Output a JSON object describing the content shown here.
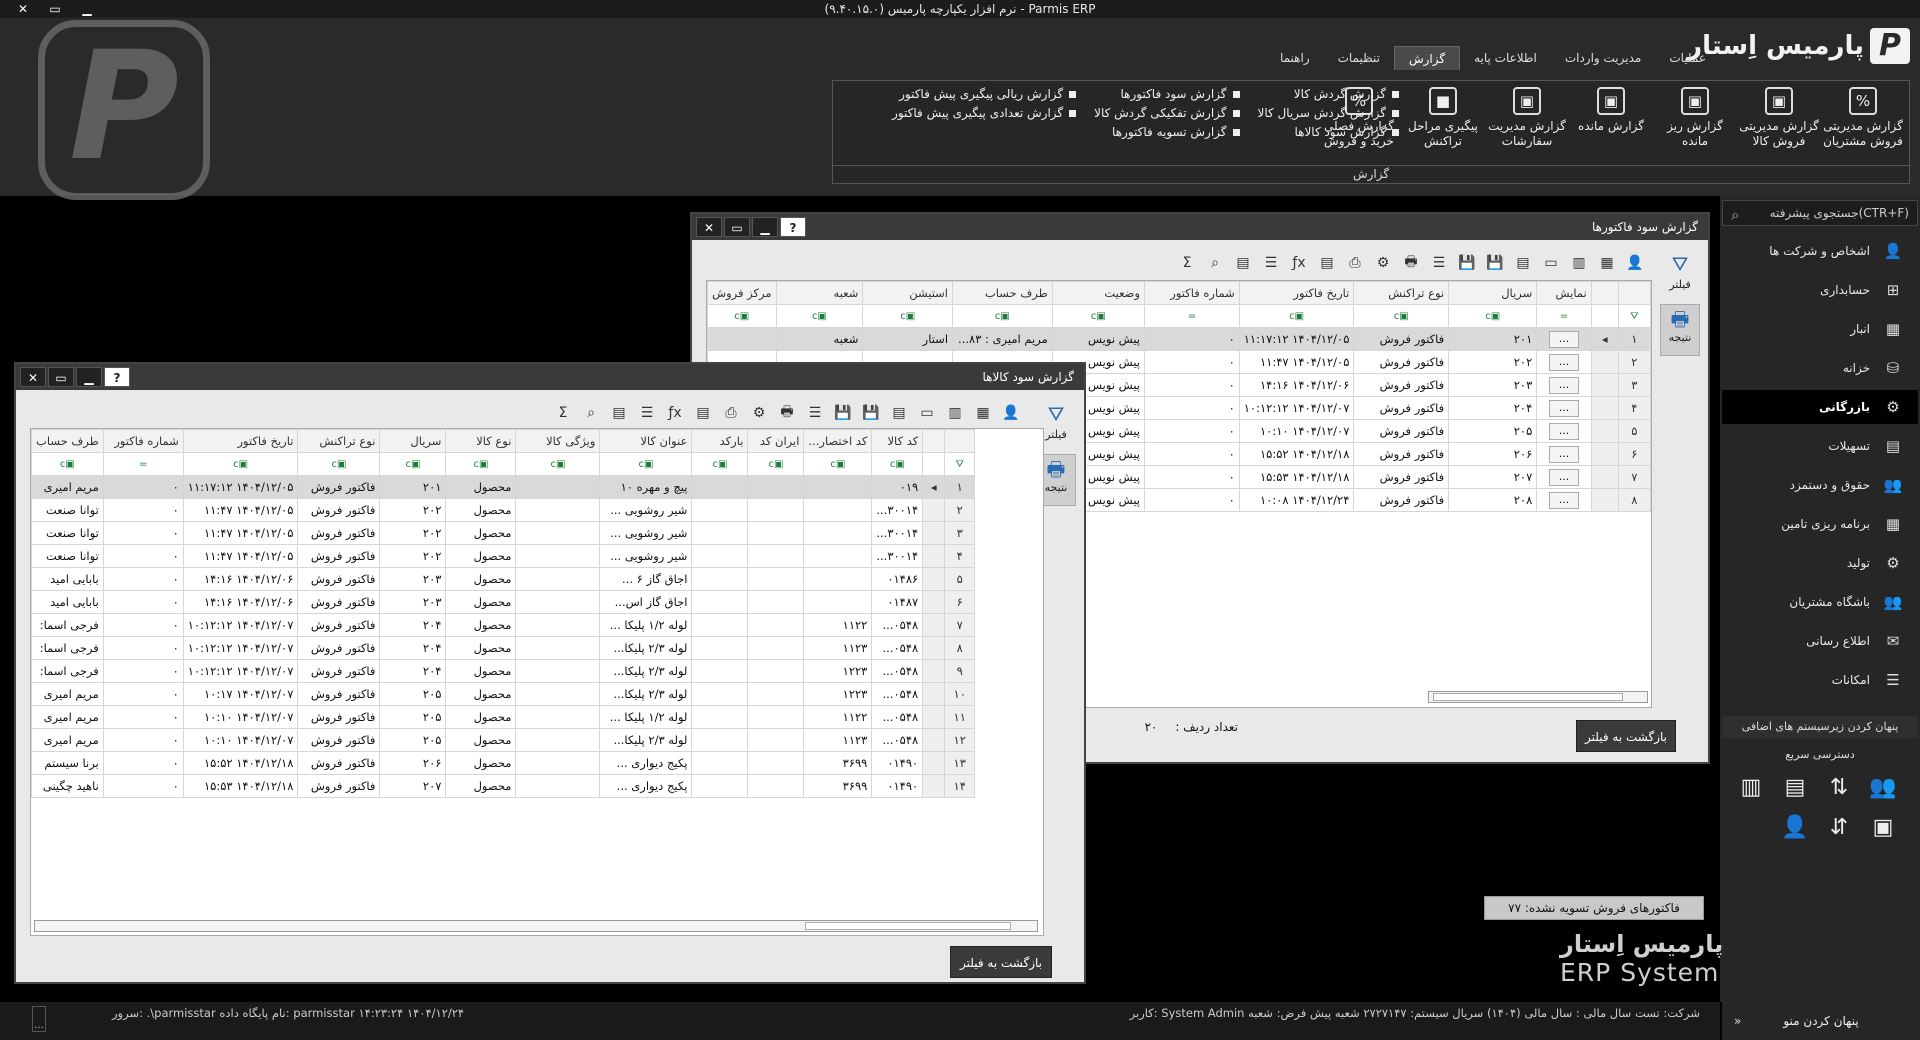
{
  "titlebar": {
    "title": "نرم افزار یکپارچه پارمیس (۹.۴۰.۱۵.۰) - Parmis ERP",
    "close": "✕",
    "restore": "▭",
    "minimize": "▁"
  },
  "brand": {
    "name": "پارمیس اِستار",
    "mark": "P"
  },
  "watermark": "P",
  "menu": [
    {
      "label": "عملیات"
    },
    {
      "label": "مدیریت واردات"
    },
    {
      "label": "اطلاعات پایه"
    },
    {
      "label": "گزارش",
      "active": true
    },
    {
      "label": "تنظیمات"
    },
    {
      "label": "راهنما"
    }
  ],
  "ribbon": {
    "big": [
      {
        "label": "گزارش مدیریتی فروش مشتریان",
        "icon": "%"
      },
      {
        "label": "گزارش مدیریتی فروش کالا",
        "icon": "▣"
      },
      {
        "label": "گزارش ریز مانده",
        "icon": "▣"
      },
      {
        "label": "گزارش مانده",
        "icon": "▣"
      },
      {
        "label": "گزارش مدیریت سفارشات",
        "icon": "▣"
      },
      {
        "label": "پیگیری مراحل تراکنش",
        "icon": "■"
      },
      {
        "label": "گزارش فصلی خرید و فروش",
        "icon": "%"
      }
    ],
    "small_cols": [
      [
        "گزارش گردش کالا",
        "گزارش گردش سریال کالا",
        "گزارش سود کالاها"
      ],
      [
        "گزارش سود فاکتورها",
        "گزارش تفکیکی گردش کالا",
        "گزارش تسویه فاکتورها"
      ],
      [
        "گزارش ریالی پیگیری پیش فاکتور",
        "گزارش تعدادی پیگیری پیش فاکتور"
      ]
    ],
    "group_label": "گزارش"
  },
  "sidebar": {
    "search_placeholder": "جستجوی پیشرفته(CTR+F)",
    "items": [
      {
        "label": "اشخاص و شرکت ها",
        "icon": "👤"
      },
      {
        "label": "حسابداری",
        "icon": "⊞"
      },
      {
        "label": "انبار",
        "icon": "▦"
      },
      {
        "label": "خزانه",
        "icon": "⛁"
      },
      {
        "label": "بازرگانی",
        "icon": "⚙",
        "active": true
      },
      {
        "label": "تسهیلات",
        "icon": "▤"
      },
      {
        "label": "حقوق و دستمزد",
        "icon": "👥"
      },
      {
        "label": "برنامه ریزی تامین",
        "icon": "▦"
      },
      {
        "label": "تولید",
        "icon": "⚙"
      },
      {
        "label": "باشگاه مشتریان",
        "icon": "👥"
      },
      {
        "label": "اطلاع رسانی",
        "icon": "✉"
      },
      {
        "label": "امکانات",
        "icon": "☰"
      }
    ],
    "hide_subsystems": "پنهان کردن زیرسیستم های اضافی",
    "quick_access": "دسترسی سریع",
    "quick_icons": [
      "👥",
      "⇅",
      "▤",
      "▥",
      "▣",
      "⇵",
      "👤"
    ],
    "hide_menu": "پنهان کردن منو",
    "hide_menu_arrow": "»"
  },
  "status": {
    "right": "کاربر:  System Admin   شرکت:  تست   سال مالی :  سال مالی (۱۴۰۴)   سریال سیستم:  ۲۷۲۷۱۴۷   شعبه پیش فرض:  شعبه",
    "left": "سرور:  .\\parmisstar   نام پایگاه داده:  parmisstar   ۱۴:۲۳:۲۴   ۱۴۰۴/۱۲/۲۴",
    "dot": "..."
  },
  "desktop": {
    "brand_fa": "پارمیس اِستار",
    "brand_en": "ERP System",
    "unsettled": "فاکتورهای فروش تسویه نشده: ۷۷"
  },
  "win_invoice": {
    "title": "گزارش سود فاکتورها",
    "filter_tab": "فیلتر",
    "result_tab": "نتیجه",
    "columns": [
      "نمایش",
      "سریال",
      "نوع تراکنش",
      "تاریخ فاکتور",
      "شماره فاکتور",
      "وضعیت",
      "طرف حساب",
      "استیشن",
      "شعبه",
      "مرکز فروش"
    ],
    "rows": [
      {
        "n": "۱",
        "serial": "۲۰۱",
        "type": "فاکتور فروش",
        "date": "۱۴۰۴/۱۲/۰۵ ۱۱:۱۷:۱۲",
        "num": "۰",
        "status": "پیش نویس",
        "party": "مریم امیری : ۸۳...",
        "station": "استار",
        "branch": "شعبه"
      },
      {
        "n": "۲",
        "serial": "۲۰۲",
        "type": "فاکتور فروش",
        "date": "۱۴۰۴/۱۲/۰۵ ۱۱:۴۷",
        "num": "۰",
        "status": "پیش نویس"
      },
      {
        "n": "۳",
        "serial": "۲۰۳",
        "type": "فاکتور فروش",
        "date": "۱۴۰۴/۱۲/۰۶ ۱۴:۱۶",
        "num": "۰",
        "status": "پیش نویس"
      },
      {
        "n": "۴",
        "serial": "۲۰۴",
        "type": "فاکتور فروش",
        "date": "۱۴۰۴/۱۲/۰۷ ۱۰:۱۲:۱۲",
        "num": "۰",
        "status": "پیش نویس"
      },
      {
        "n": "۵",
        "serial": "۲۰۵",
        "type": "فاکتور فروش",
        "date": "۱۴۰۴/۱۲/۰۷ ۱۰:۱۰",
        "num": "۰",
        "status": "پیش نویس"
      },
      {
        "n": "۶",
        "serial": "۲۰۶",
        "type": "فاکتور فروش",
        "date": "۱۴۰۴/۱۲/۱۸ ۱۵:۵۲",
        "num": "۰",
        "status": "پیش نویس"
      },
      {
        "n": "۷",
        "serial": "۲۰۷",
        "type": "فاکتور فروش",
        "date": "۱۴۰۴/۱۲/۱۸ ۱۵:۵۳",
        "num": "۰",
        "status": "پیش نویس"
      },
      {
        "n": "۸",
        "serial": "۲۰۸",
        "type": "فاکتور فروش",
        "date": "۱۴۰۴/۱۲/۲۴ ۱۰:۰۸",
        "num": "۰",
        "status": "پیش نویس"
      }
    ],
    "row_count_label": "تعداد ردیف :",
    "row_count": "۲۰",
    "back": "بازگشت به فیلتر"
  },
  "win_goods": {
    "title": "گزارش سود کالاها",
    "filter_tab": "فیلتر",
    "result_tab": "نتیجه",
    "columns": [
      "کد کالا",
      "کد اختصار...",
      "ایران کد",
      "بارکد",
      "عنوان کالا",
      "ویژگی کالا",
      "نوع کالا",
      "سریال",
      "نوع تراکنش",
      "تاریخ فاکتور",
      "شماره فاکتور",
      "طرف حساب"
    ],
    "rows": [
      {
        "n": "۱",
        "code": "۰۱۹",
        "short": "",
        "title": "پیچ و مهره ۱۰",
        "kind": "محصول",
        "serial": "۲۰۱",
        "type": "فاکتور فروش",
        "date": "۱۴۰۴/۱۲/۰۵ ۱۱:۱۷:۱۲",
        "num": "۰",
        "party": "مریم امیری"
      },
      {
        "n": "۲",
        "code": "۳۰۰۱۴...",
        "short": "",
        "title": "شیر روشویی ...",
        "kind": "محصول",
        "serial": "۲۰۲",
        "type": "فاکتور فروش",
        "date": "۱۴۰۴/۱۲/۰۵ ۱۱:۴۷",
        "num": "۰",
        "party": "توانا صنعت"
      },
      {
        "n": "۳",
        "code": "۳۰۰۱۴...",
        "short": "",
        "title": "شیر روشویی ...",
        "kind": "محصول",
        "serial": "۲۰۲",
        "type": "فاکتور فروش",
        "date": "۱۴۰۴/۱۲/۰۵ ۱۱:۴۷",
        "num": "۰",
        "party": "توانا صنعت"
      },
      {
        "n": "۴",
        "code": "۳۰۰۱۴...",
        "short": "",
        "title": "شیر روشویی ...",
        "kind": "محصول",
        "serial": "۲۰۲",
        "type": "فاکتور فروش",
        "date": "۱۴۰۴/۱۲/۰۵ ۱۱:۴۷",
        "num": "۰",
        "party": "توانا صنعت"
      },
      {
        "n": "۵",
        "code": "۰۱۴۸۶",
        "short": "",
        "title": "اجاق گاز ۶ ...",
        "kind": "محصول",
        "serial": "۲۰۳",
        "type": "فاکتور فروش",
        "date": "۱۴۰۴/۱۲/۰۶ ۱۴:۱۶",
        "num": "۰",
        "party": "بابایی امید"
      },
      {
        "n": "۶",
        "code": "۰۱۴۸۷",
        "short": "",
        "title": "اجاق گاز اس...",
        "kind": "محصول",
        "serial": "۲۰۳",
        "type": "فاکتور فروش",
        "date": "۱۴۰۴/۱۲/۰۶ ۱۴:۱۶",
        "num": "۰",
        "party": "بابایی امید"
      },
      {
        "n": "۷",
        "code": "۰۵۴۸...",
        "short": "۱۱۲۲",
        "title": "لوله ۱/۲ پلیکا ...",
        "kind": "محصول",
        "serial": "۲۰۴",
        "type": "فاکتور فروش",
        "date": "۱۴۰۴/۱۲/۰۷ ۱۰:۱۲:۱۲",
        "num": "۰",
        "party": "فرجی اسما:"
      },
      {
        "n": "۸",
        "code": "۰۵۴۸...",
        "short": "۱۱۲۳",
        "title": "لوله ۲/۳ پلیکا...",
        "kind": "محصول",
        "serial": "۲۰۴",
        "type": "فاکتور فروش",
        "date": "۱۴۰۴/۱۲/۰۷ ۱۰:۱۲:۱۲",
        "num": "۰",
        "party": "فرجی اسما:"
      },
      {
        "n": "۹",
        "code": "۰۵۴۸...",
        "short": "۱۲۲۳",
        "title": "لوله ۲/۳ پلیکا...",
        "kind": "محصول",
        "serial": "۲۰۴",
        "type": "فاکتور فروش",
        "date": "۱۴۰۴/۱۲/۰۷ ۱۰:۱۲:۱۲",
        "num": "۰",
        "party": "فرجی اسما:"
      },
      {
        "n": "۱۰",
        "code": "۰۵۴۸...",
        "short": "۱۲۲۳",
        "title": "لوله ۲/۳ پلیکا...",
        "kind": "محصول",
        "serial": "۲۰۵",
        "type": "فاکتور فروش",
        "date": "۱۴۰۴/۱۲/۰۷ ۱۰:۱۷",
        "num": "۰",
        "party": "مریم امیری"
      },
      {
        "n": "۱۱",
        "code": "۰۵۴۸...",
        "short": "۱۱۲۲",
        "title": "لوله ۱/۲ پلیکا ...",
        "kind": "محصول",
        "serial": "۲۰۵",
        "type": "فاکتور فروش",
        "date": "۱۴۰۴/۱۲/۰۷ ۱۰:۱۰",
        "num": "۰",
        "party": "مریم امیری"
      },
      {
        "n": "۱۲",
        "code": "۰۵۴۸...",
        "short": "۱۱۲۳",
        "title": "لوله ۲/۳ پلیکا...",
        "kind": "محصول",
        "serial": "۲۰۵",
        "type": "فاکتور فروش",
        "date": "۱۴۰۴/۱۲/۰۷ ۱۰:۱۰",
        "num": "۰",
        "party": "مریم امیری"
      },
      {
        "n": "۱۳",
        "code": "۰۱۴۹۰",
        "short": "۳۶۹۹",
        "title": "پکیج دیواری ...",
        "kind": "محصول",
        "serial": "۲۰۶",
        "type": "فاکتور فروش",
        "date": "۱۴۰۴/۱۲/۱۸ ۱۵:۵۲",
        "num": "۰",
        "party": "برنا سیستم"
      },
      {
        "n": "۱۴",
        "code": "۰۱۴۹۰",
        "short": "۳۶۹۹",
        "title": "پکیج دیواری ...",
        "kind": "محصول",
        "serial": "۲۰۷",
        "type": "فاکتور فروش",
        "date": "۱۴۰۴/۱۲/۱۸ ۱۵:۵۳",
        "num": "۰",
        "party": "ناهید چگینی"
      }
    ],
    "back": "بازگشت به فیلتر"
  },
  "toolbar_icons": [
    "👤",
    "▦",
    "▥",
    "▭",
    "▤",
    "💾",
    "💾",
    "☰",
    "🖶",
    "⚙",
    "⎙",
    "▤",
    "ƒx",
    "☰",
    "▤",
    "⌕",
    "Σ"
  ]
}
